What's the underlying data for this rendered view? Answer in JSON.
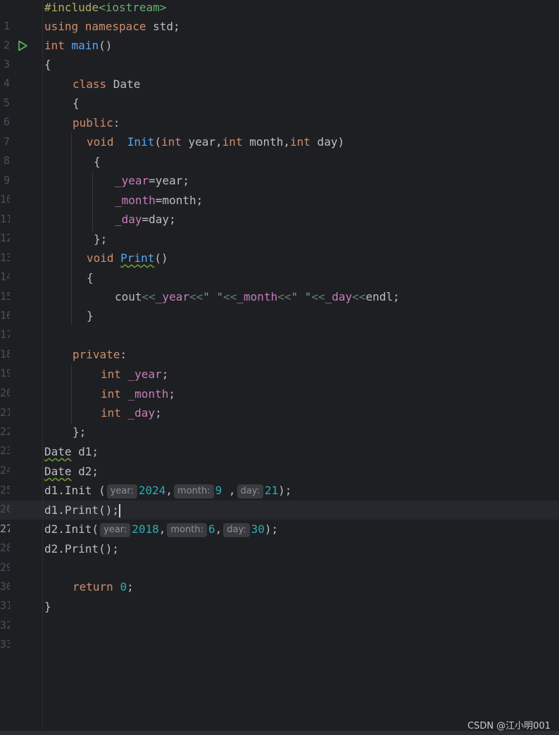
{
  "editor": {
    "lines": [
      {
        "n": "1"
      },
      {
        "n": "2"
      },
      {
        "n": "3"
      },
      {
        "n": "4"
      },
      {
        "n": "5"
      },
      {
        "n": "6"
      },
      {
        "n": "7"
      },
      {
        "n": "8"
      },
      {
        "n": "9"
      },
      {
        "n": "10"
      },
      {
        "n": "11"
      },
      {
        "n": "12"
      },
      {
        "n": "13"
      },
      {
        "n": "14"
      },
      {
        "n": "15"
      },
      {
        "n": "16"
      },
      {
        "n": "17"
      },
      {
        "n": "18"
      },
      {
        "n": "19"
      },
      {
        "n": "20"
      },
      {
        "n": "21"
      },
      {
        "n": "22"
      },
      {
        "n": "23"
      },
      {
        "n": "24"
      },
      {
        "n": "25"
      },
      {
        "n": "26"
      },
      {
        "n": "27"
      },
      {
        "n": "28"
      },
      {
        "n": "29"
      },
      {
        "n": "30"
      },
      {
        "n": "31"
      },
      {
        "n": "32"
      },
      {
        "n": "33"
      }
    ],
    "current_line": "27",
    "code": {
      "l1_a": "#include",
      "l1_b": "<iostream>",
      "l2_a": "using namespace",
      "l2_b": " std;",
      "l3_a": "int",
      "l3_b": " ",
      "l3_c": "main",
      "l3_d": "()",
      "l4": "{",
      "l5_a": "class",
      "l5_b": " Date",
      "l6": "{",
      "l7_a": "public",
      "l7_b": ":",
      "l8_a": "void",
      "l8_b": "  ",
      "l8_c": "Init",
      "l8_d": "(",
      "l8_e": "int",
      "l8_f": " year,",
      "l8_g": "int",
      "l8_h": " month,",
      "l8_i": "int",
      "l8_j": " day)",
      "l9": "{",
      "l10_a": "_year",
      "l10_b": "=year;",
      "l11_a": "_month",
      "l11_b": "=month;",
      "l12_a": "_day",
      "l12_b": "=day;",
      "l13": "};",
      "l14_a": "void",
      "l14_b": " ",
      "l14_c": "Print",
      "l14_d": "()",
      "l15": "{",
      "l16_a": "cout",
      "l16_b": "<<",
      "l16_c": "_year",
      "l16_d": "<<",
      "l16_e": "\" \"",
      "l16_f": "<<",
      "l16_g": "_month",
      "l16_h": "<<",
      "l16_i": "\" \"",
      "l16_j": "<<",
      "l16_k": "_day",
      "l16_l": "<<",
      "l16_m": "endl;",
      "l17": "}",
      "l19_a": "private",
      "l19_b": ":",
      "l20_a": "int",
      "l20_b": " _year",
      "l20_c": ";",
      "l21_a": "int",
      "l21_b": " _month",
      "l21_c": ";",
      "l22_a": "int",
      "l22_b": " _day",
      "l22_c": ";",
      "l23": "};",
      "l24_a": "Date",
      "l24_b": " d1;",
      "l25_a": "Date",
      "l25_b": " d2;",
      "l26_a": "d1.Init (",
      "l26_h1": "year:",
      "l26_v1": "2024",
      "l26_s1": ",",
      "l26_h2": "month:",
      "l26_v2": "9",
      "l26_s2": " ,",
      "l26_h3": "day:",
      "l26_v3": "21",
      "l26_e": ");",
      "l27": "d1.Print();",
      "l28_a": "d2.Init(",
      "l28_h1": "year:",
      "l28_v1": "2018",
      "l28_s1": ",",
      "l28_h2": "month:",
      "l28_v2": "6",
      "l28_s2": ",",
      "l28_h3": "day:",
      "l28_v3": "30",
      "l28_e": ");",
      "l29": "d2.Print();",
      "l31_a": "return",
      "l31_b": " ",
      "l31_c": "0",
      "l31_d": ";",
      "l32": "}"
    }
  },
  "watermark": "CSDN @江小明001",
  "colors": {
    "background": "#1e1f22",
    "keyword": "#cf8e6d",
    "function": "#56a8f5",
    "field": "#c77dbb",
    "number": "#2aacb8",
    "string": "#6aab73",
    "text": "#bcbec4"
  }
}
